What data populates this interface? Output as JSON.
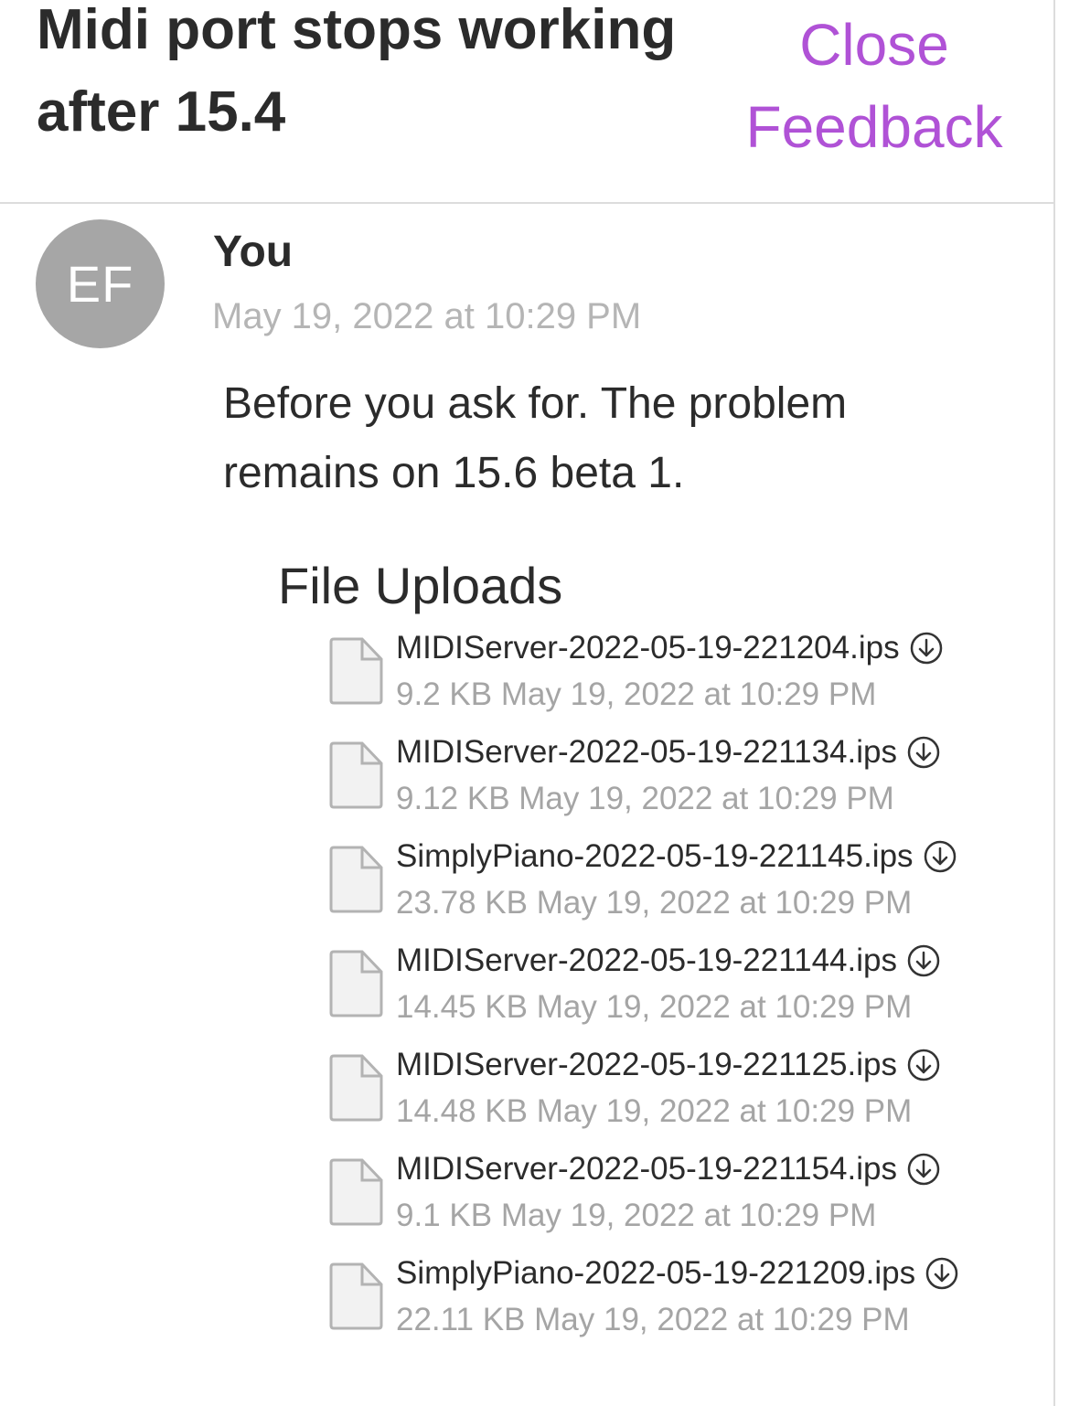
{
  "header": {
    "title": "Midi port stops working after 15.4",
    "close_label_line1": "Close",
    "close_label_line2": "Feedback",
    "accent_color": "#b052d6"
  },
  "message": {
    "avatar_initials": "EF",
    "sender": "You",
    "timestamp": "May 19, 2022 at 10:29 PM",
    "body": "Before you ask for. The problem remains on 15.6 beta 1."
  },
  "uploads": {
    "heading": "File Uploads",
    "files": [
      {
        "name": "MIDIServer-2022-05-19-221204.ips",
        "size": "9.2 KB",
        "date": "May 19, 2022 at 10:29 PM",
        "icon": "document-icon",
        "action_icon": "download-icon"
      },
      {
        "name": "MIDIServer-2022-05-19-221134.ips",
        "size": "9.12 KB",
        "date": "May 19, 2022 at 10:29 PM",
        "icon": "document-icon",
        "action_icon": "download-icon"
      },
      {
        "name": "SimplyPiano-2022-05-19-221145.ips",
        "size": "23.78 KB",
        "date": "May 19, 2022 at 10:29 PM",
        "icon": "document-icon",
        "action_icon": "download-icon"
      },
      {
        "name": "MIDIServer-2022-05-19-221144.ips",
        "size": "14.45 KB",
        "date": "May 19, 2022 at 10:29 PM",
        "icon": "document-icon",
        "action_icon": "download-icon"
      },
      {
        "name": "MIDIServer-2022-05-19-221125.ips",
        "size": "14.48 KB",
        "date": "May 19, 2022 at 10:29 PM",
        "icon": "document-icon",
        "action_icon": "download-icon"
      },
      {
        "name": "MIDIServer-2022-05-19-221154.ips",
        "size": "9.1 KB",
        "date": "May 19, 2022 at 10:29 PM",
        "icon": "document-icon",
        "action_icon": "download-icon"
      },
      {
        "name": "SimplyPiano-2022-05-19-221209.ips",
        "size": "22.11 KB",
        "date": "May 19, 2022 at 10:29 PM",
        "icon": "document-icon",
        "action_icon": "download-icon"
      }
    ]
  }
}
